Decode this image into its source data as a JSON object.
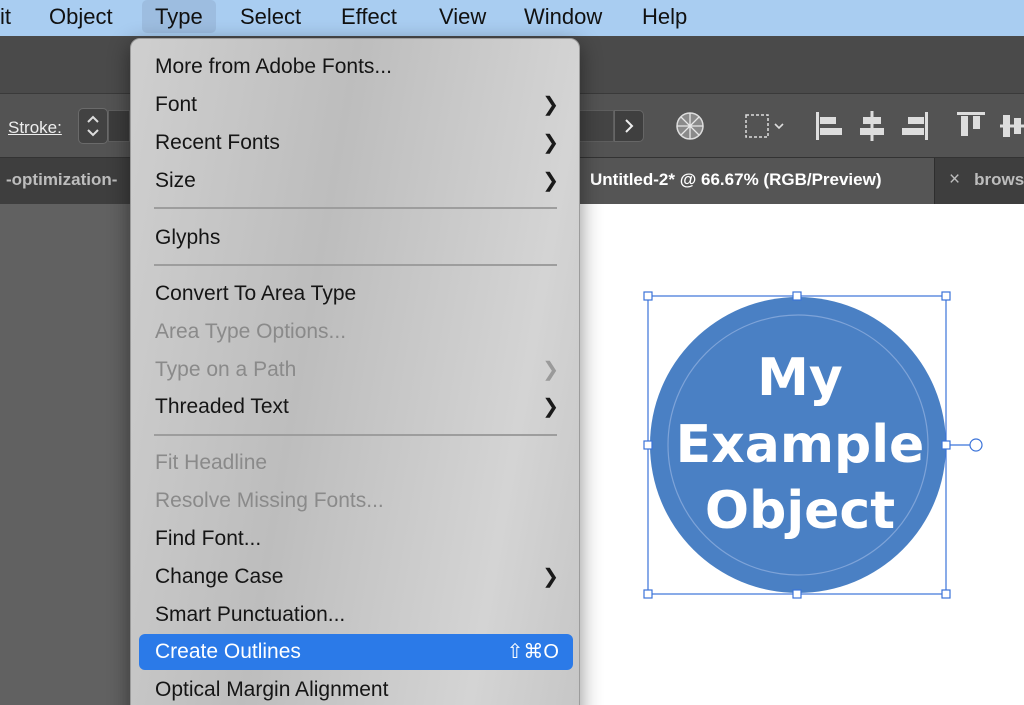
{
  "menubar": {
    "items": [
      "it",
      "Object",
      "Type",
      "Select",
      "Effect",
      "View",
      "Window",
      "Help"
    ],
    "active": "Type"
  },
  "control_bar": {
    "stroke_label": "Stroke:"
  },
  "tabs": [
    {
      "label": "-optimization-"
    },
    {
      "label": "Untitled-2* @ 66.67% (RGB/Preview)",
      "active": true
    },
    {
      "close": "×",
      "label": "brows"
    }
  ],
  "artwork": {
    "lines": [
      "My",
      "Example",
      "Object"
    ],
    "fill_color": "#4a80c4",
    "text_color": "#ffffff",
    "selection_color": "#3b73d9"
  },
  "type_menu": {
    "items": [
      {
        "label": "More from Adobe Fonts...",
        "enabled": true
      },
      {
        "label": "Font",
        "enabled": true,
        "submenu": true
      },
      {
        "label": "Recent Fonts",
        "enabled": true,
        "submenu": true
      },
      {
        "label": "Size",
        "enabled": true,
        "submenu": true
      },
      {
        "label": "Glyphs",
        "enabled": true
      },
      {
        "label": "Convert To Area Type",
        "enabled": true
      },
      {
        "label": "Area Type Options...",
        "enabled": false
      },
      {
        "label": "Type on a Path",
        "enabled": false,
        "submenu": true
      },
      {
        "label": "Threaded Text",
        "enabled": true,
        "submenu": true
      },
      {
        "label": "Fit Headline",
        "enabled": false
      },
      {
        "label": "Resolve Missing Fonts...",
        "enabled": false
      },
      {
        "label": "Find Font...",
        "enabled": true
      },
      {
        "label": "Change Case",
        "enabled": true,
        "submenu": true
      },
      {
        "label": "Smart Punctuation...",
        "enabled": true
      },
      {
        "label": "Create Outlines",
        "enabled": true,
        "highlighted": true,
        "shortcut": "⇧⌘O"
      },
      {
        "label": "Optical Margin Alignment",
        "enabled": true
      }
    ],
    "highlight_color": "#2b7ae8"
  }
}
